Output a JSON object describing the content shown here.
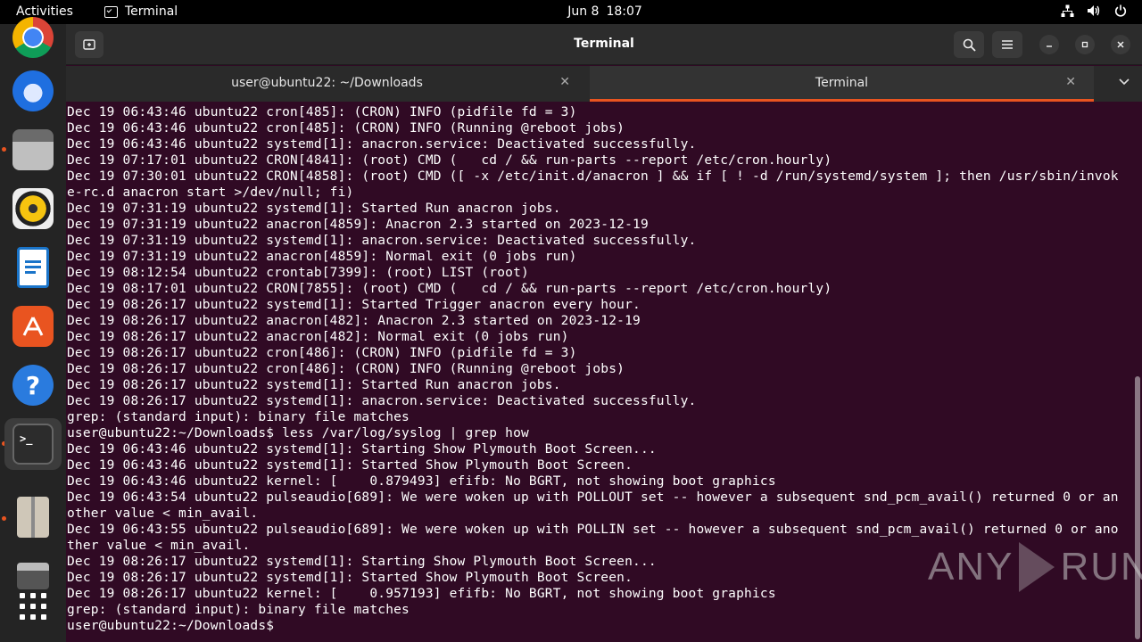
{
  "topbar": {
    "activities": "Activities",
    "app_name": "Terminal",
    "date": "Jun 8",
    "time": "18:07"
  },
  "dock": {
    "apps": [
      "chrome-icon",
      "thunderbird-icon",
      "files-icon",
      "rhythmbox-icon",
      "writer-icon",
      "app-center-icon",
      "help-icon",
      "terminal-icon",
      "archive-icon",
      "disk-icon",
      "show-apps-icon"
    ]
  },
  "window": {
    "title": "Terminal",
    "tabs": [
      {
        "label": "user@ubuntu22: ~/Downloads"
      },
      {
        "label": "Terminal"
      }
    ]
  },
  "terminal": {
    "lines": [
      "Dec 19 06:43:46 ubuntu22 cron[485]: (CRON) INFO (pidfile fd = 3)",
      "Dec 19 06:43:46 ubuntu22 cron[485]: (CRON) INFO (Running @reboot jobs)",
      "Dec 19 06:43:46 ubuntu22 systemd[1]: anacron.service: Deactivated successfully.",
      "Dec 19 07:17:01 ubuntu22 CRON[4841]: (root) CMD (   cd / && run-parts --report /etc/cron.hourly)",
      "Dec 19 07:30:01 ubuntu22 CRON[4858]: (root) CMD ([ -x /etc/init.d/anacron ] && if [ ! -d /run/systemd/system ]; then /usr/sbin/invok",
      "e-rc.d anacron start >/dev/null; fi)",
      "Dec 19 07:31:19 ubuntu22 systemd[1]: Started Run anacron jobs.",
      "Dec 19 07:31:19 ubuntu22 anacron[4859]: Anacron 2.3 started on 2023-12-19",
      "Dec 19 07:31:19 ubuntu22 systemd[1]: anacron.service: Deactivated successfully.",
      "Dec 19 07:31:19 ubuntu22 anacron[4859]: Normal exit (0 jobs run)",
      "Dec 19 08:12:54 ubuntu22 crontab[7399]: (root) LIST (root)",
      "Dec 19 08:17:01 ubuntu22 CRON[7855]: (root) CMD (   cd / && run-parts --report /etc/cron.hourly)",
      "Dec 19 08:26:17 ubuntu22 systemd[1]: Started Trigger anacron every hour.",
      "Dec 19 08:26:17 ubuntu22 anacron[482]: Anacron 2.3 started on 2023-12-19",
      "Dec 19 08:26:17 ubuntu22 anacron[482]: Normal exit (0 jobs run)",
      "Dec 19 08:26:17 ubuntu22 cron[486]: (CRON) INFO (pidfile fd = 3)",
      "Dec 19 08:26:17 ubuntu22 cron[486]: (CRON) INFO (Running @reboot jobs)",
      "Dec 19 08:26:17 ubuntu22 systemd[1]: Started Run anacron jobs.",
      "Dec 19 08:26:17 ubuntu22 systemd[1]: anacron.service: Deactivated successfully.",
      "grep: (standard input): binary file matches",
      "user@ubuntu22:~/Downloads$ less /var/log/syslog | grep how",
      "Dec 19 06:43:46 ubuntu22 systemd[1]: Starting Show Plymouth Boot Screen...",
      "Dec 19 06:43:46 ubuntu22 systemd[1]: Started Show Plymouth Boot Screen.",
      "Dec 19 06:43:46 ubuntu22 kernel: [    0.879493] efifb: No BGRT, not showing boot graphics",
      "Dec 19 06:43:54 ubuntu22 pulseaudio[689]: We were woken up with POLLOUT set -- however a subsequent snd_pcm_avail() returned 0 or an",
      "other value < min_avail.",
      "Dec 19 06:43:55 ubuntu22 pulseaudio[689]: We were woken up with POLLIN set -- however a subsequent snd_pcm_avail() returned 0 or ano",
      "ther value < min_avail.",
      "Dec 19 08:26:17 ubuntu22 systemd[1]: Starting Show Plymouth Boot Screen...",
      "Dec 19 08:26:17 ubuntu22 systemd[1]: Started Show Plymouth Boot Screen.",
      "Dec 19 08:26:17 ubuntu22 kernel: [    0.957193] efifb: No BGRT, not showing boot graphics",
      "grep: (standard input): binary file matches",
      "user@ubuntu22:~/Downloads$ "
    ]
  },
  "watermark": {
    "left": "ANY",
    "right": "RUN"
  },
  "colors": {
    "accent": "#e95420",
    "terminal_bg": "#300a24"
  }
}
